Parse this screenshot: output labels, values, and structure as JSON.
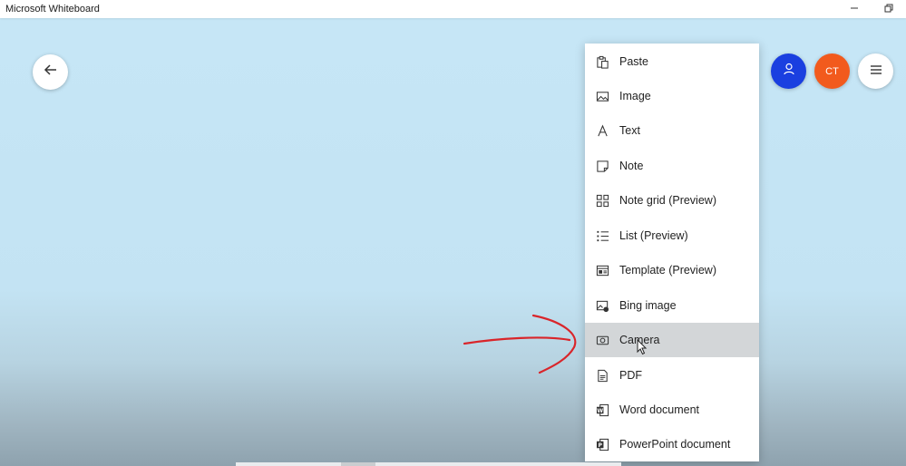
{
  "window": {
    "title": "Microsoft Whiteboard",
    "controls": [
      "minimize-icon",
      "restore-icon"
    ]
  },
  "toolbar": {
    "back_icon": "arrow-left-icon",
    "share_icon": "person-icon",
    "avatar_initials": "CT",
    "menu_icon": "hamburger-icon"
  },
  "insert_menu": {
    "items": [
      {
        "label": "Paste",
        "icon": "paste-icon"
      },
      {
        "label": "Image",
        "icon": "image-icon"
      },
      {
        "label": "Text",
        "icon": "text-icon"
      },
      {
        "label": "Note",
        "icon": "note-icon"
      },
      {
        "label": "Note grid (Preview)",
        "icon": "note-grid-icon"
      },
      {
        "label": "List (Preview)",
        "icon": "list-icon"
      },
      {
        "label": "Template (Preview)",
        "icon": "template-icon"
      },
      {
        "label": "Bing image",
        "icon": "bing-image-icon"
      },
      {
        "label": "Camera",
        "icon": "camera-icon",
        "state": "hover"
      },
      {
        "label": "PDF",
        "icon": "pdf-icon"
      },
      {
        "label": "Word document",
        "icon": "word-icon"
      },
      {
        "label": "PowerPoint document",
        "icon": "powerpoint-icon"
      }
    ]
  },
  "colors": {
    "canvas_top": "#c6e6f6",
    "share_button": "#1a3fe0",
    "avatar": "#f25a1d",
    "annotation_ink": "#d9252a",
    "hover_row": "#d3d6d8"
  }
}
